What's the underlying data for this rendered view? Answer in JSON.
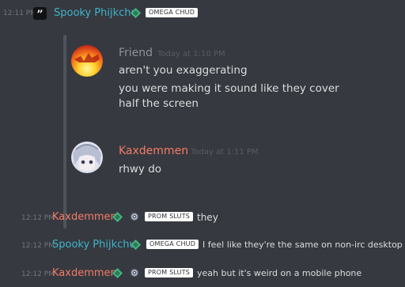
{
  "header": {
    "timestamp": "12:11 PM",
    "username": "Spooky Phijkchu",
    "badge": "OMEGA CHUD"
  },
  "quote": {
    "messages": [
      {
        "username": "Friend",
        "timestamp": "Today at 1:10 PM",
        "lines": [
          "aren't you exaggerating",
          "you were making it sound like they cover",
          "half the screen"
        ]
      },
      {
        "username": "Kaxdemmen",
        "timestamp": "Today at 1:11 PM",
        "lines": [
          "rhwy do"
        ]
      }
    ]
  },
  "messages": [
    {
      "timestamp": "12:12 PM",
      "username": "Kaxdemmen",
      "badge": "PROM SLUTS",
      "text": "they"
    },
    {
      "timestamp": "12:12 PM",
      "username": "Spooky Phijkchu",
      "badge": "OMEGA CHUD",
      "text": "I feel like they're the same on non-irc desktop"
    },
    {
      "timestamp": "12:12 PM",
      "username": "Kaxdemmen",
      "badge": "PROM SLUTS",
      "text": "yeah but it's weird on a mobile phone"
    }
  ],
  "colors": {
    "background": "#36393f",
    "teal_name": "#3fb4cc",
    "salmon_name": "#f47b67",
    "timestamp": "#72767d",
    "gem": "#43b581"
  },
  "icons": [
    "quote-icon",
    "verified-gem-icon",
    "spiral-icon"
  ]
}
